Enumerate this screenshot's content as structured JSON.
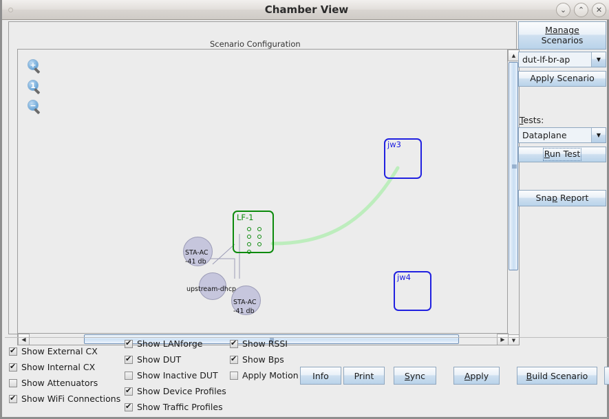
{
  "window": {
    "title": "Chamber View",
    "buttons": [
      {
        "name": "minimize",
        "glyph": "⌄"
      },
      {
        "name": "maximize",
        "glyph": "⌃"
      },
      {
        "name": "close",
        "glyph": "✕"
      }
    ]
  },
  "group": {
    "title": "Scenario Configuration"
  },
  "canvas": {
    "zoom_tools": [
      {
        "name": "zoom-in-icon",
        "glyph": "+"
      },
      {
        "name": "zoom-reset-icon",
        "glyph": "1"
      },
      {
        "name": "zoom-out-icon",
        "glyph": "−"
      }
    ],
    "nodes": [
      {
        "id": "sta-ac-1",
        "type": "circle",
        "label": "STA-AC",
        "sublabel": "-41 db"
      },
      {
        "id": "upstream-dhcp",
        "type": "circle",
        "label": "upstream-dhcp",
        "sublabel": ""
      },
      {
        "id": "sta-ac-2",
        "type": "circle",
        "label": "STA-AC",
        "sublabel": "-41 db"
      },
      {
        "id": "lf-1",
        "type": "box",
        "label": "LF-1",
        "color": "#0b8a0b",
        "ports": 7
      },
      {
        "id": "jw3",
        "type": "box",
        "label": "jw3",
        "color": "#2020e0"
      },
      {
        "id": "jw4",
        "type": "box",
        "label": "jw4",
        "color": "#2020e0"
      }
    ],
    "connection_color": "#bdedbd"
  },
  "scrollbars": {
    "vertical": {
      "up": "▲",
      "down": "▼"
    },
    "horizontal": {
      "left": "◀",
      "right": "▶"
    }
  },
  "sidebar": {
    "manage_scenarios_line1": "Manage",
    "manage_scenarios_line2": "Scenarios",
    "scenario_value": "dut-lf-br-ap",
    "apply_scenario": "Apply Scenario",
    "tests_label": "Tests:",
    "test_value": "Dataplane",
    "run_test": "Run Test",
    "snap_report": "Snap Report",
    "arrow": "▼"
  },
  "checkboxes": {
    "column1": [
      {
        "label": "Show External CX",
        "checked": true
      },
      {
        "label": "Show Internal CX",
        "checked": true
      },
      {
        "label": "Show Attenuators",
        "checked": false
      },
      {
        "label": "Show WiFi Connections",
        "checked": true
      }
    ],
    "column2": [
      {
        "label": "Show LANforge",
        "checked": true
      },
      {
        "label": "Show DUT",
        "checked": true
      },
      {
        "label": "Show Inactive DUT",
        "checked": false
      },
      {
        "label": "Show Device Profiles",
        "checked": true
      },
      {
        "label": "Show Traffic Profiles",
        "checked": true
      }
    ],
    "column3": [
      {
        "label": "Show RSSI",
        "checked": true
      },
      {
        "label": "Show Bps",
        "checked": true
      },
      {
        "label": "Apply Motion",
        "checked": false
      }
    ]
  },
  "bottom_buttons": [
    {
      "label": "Info"
    },
    {
      "label": "Print"
    },
    {
      "label": "Sync"
    },
    {
      "label": "Apply"
    },
    {
      "label": "Build Scenario"
    }
  ]
}
